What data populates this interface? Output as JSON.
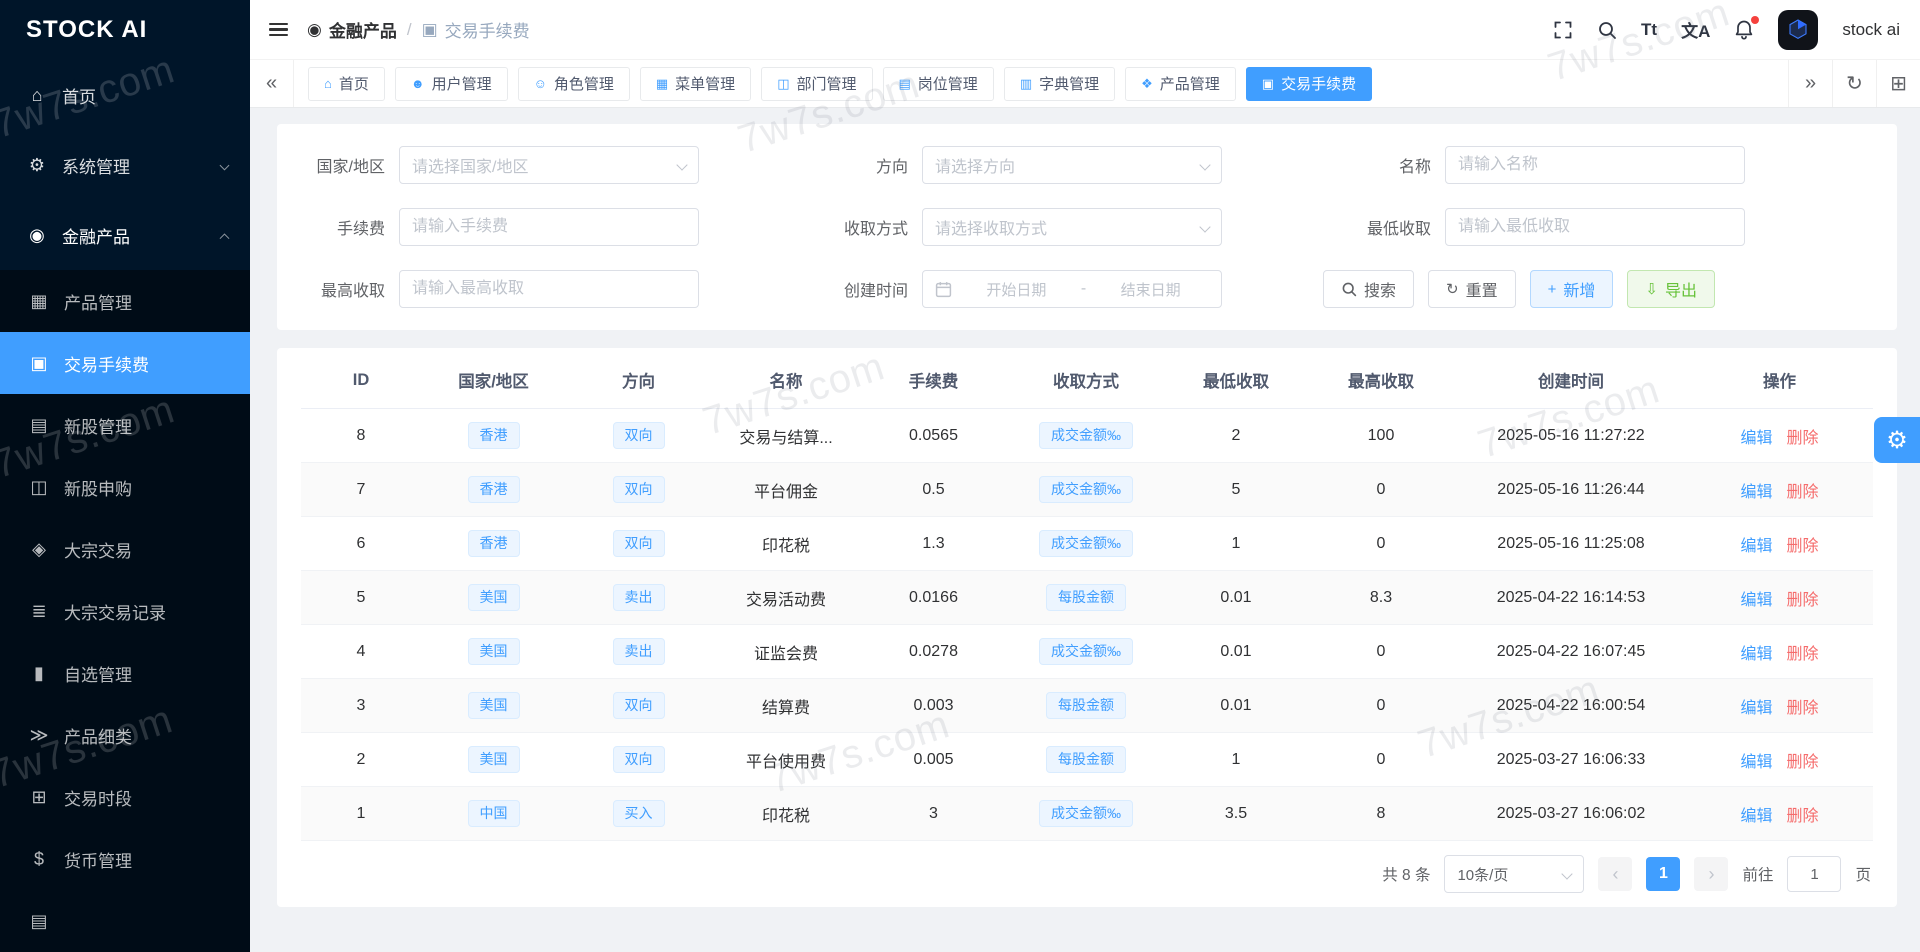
{
  "colors": {
    "primary": "#409eff",
    "danger": "#f56c6c",
    "success": "#67c23a",
    "sidebar_bg": "#001529"
  },
  "watermark": {
    "text": "7w7s.com"
  },
  "icons": {
    "collapse_left": "«",
    "collapse_right": "»",
    "refresh": "↻",
    "grid": "⊞",
    "plus": "+",
    "download": "⇩",
    "prev": "‹",
    "next": "›",
    "gear": "⚙"
  },
  "sidebar": {
    "logo": "STOCK AI",
    "items": [
      {
        "label": "首页",
        "icon": "⌂"
      },
      {
        "label": "系统管理",
        "icon": "⚙"
      },
      {
        "label": "金融产品",
        "icon": "◉"
      }
    ],
    "submenu": [
      {
        "label": "产品管理",
        "icon": "▦"
      },
      {
        "label": "交易手续费",
        "icon": "▣"
      },
      {
        "label": "新股管理",
        "icon": "▤"
      },
      {
        "label": "新股申购",
        "icon": "◫"
      },
      {
        "label": "大宗交易",
        "icon": "◈"
      },
      {
        "label": "大宗交易记录",
        "icon": "≣"
      },
      {
        "label": "自选管理",
        "icon": "▮"
      },
      {
        "label": "产品细类",
        "icon": "≫"
      },
      {
        "label": "交易时段",
        "icon": "⊞"
      },
      {
        "label": "货币管理",
        "icon": "$"
      },
      {
        "label": "",
        "icon": "▤"
      }
    ]
  },
  "header": {
    "breadcrumb": {
      "parent": "金融产品",
      "separator": "/",
      "current": "交易手续费"
    },
    "tools": {
      "font_size": "Tt",
      "translate": "文A"
    },
    "username": "stock ai"
  },
  "tabs": [
    {
      "label": "首页",
      "icon": "⌂"
    },
    {
      "label": "用户管理",
      "icon": "☻"
    },
    {
      "label": "角色管理",
      "icon": "☺"
    },
    {
      "label": "菜单管理",
      "icon": "▦"
    },
    {
      "label": "部门管理",
      "icon": "◫"
    },
    {
      "label": "岗位管理",
      "icon": "▤"
    },
    {
      "label": "字典管理",
      "icon": "▥"
    },
    {
      "label": "产品管理",
      "icon": "❖"
    },
    {
      "label": "交易手续费",
      "icon": "▣"
    }
  ],
  "filters": {
    "fields": [
      {
        "label": "国家/地区",
        "placeholder": "请选择国家/地区"
      },
      {
        "label": "方向",
        "placeholder": "请选择方向"
      },
      {
        "label": "名称",
        "placeholder": "请输入名称"
      },
      {
        "label": "手续费",
        "placeholder": "请输入手续费"
      },
      {
        "label": "收取方式",
        "placeholder": "请选择收取方式"
      },
      {
        "label": "最低收取",
        "placeholder": "请输入最低收取"
      },
      {
        "label": "最高收取",
        "placeholder": "请输入最高收取"
      },
      {
        "label": "创建时间",
        "start_placeholder": "开始日期",
        "separator": "-",
        "end_placeholder": "结束日期"
      }
    ],
    "buttons": {
      "search": "搜索",
      "reset": "重置",
      "add": "新增",
      "export": "导出"
    }
  },
  "table": {
    "columns": [
      "ID",
      "国家/地区",
      "方向",
      "名称",
      "手续费",
      "收取方式",
      "最低收取",
      "最高收取",
      "创建时间",
      "操作"
    ],
    "edit_label": "编辑",
    "delete_label": "删除",
    "rows": [
      {
        "id": "8",
        "country": "香港",
        "direction": "双向",
        "name": "交易与结算...",
        "fee": "0.0565",
        "method": "成交金额‰",
        "min": "2",
        "max": "100",
        "created": "2025-05-16 11:27:22"
      },
      {
        "id": "7",
        "country": "香港",
        "direction": "双向",
        "name": "平台佣金",
        "fee": "0.5",
        "method": "成交金额‰",
        "min": "5",
        "max": "0",
        "created": "2025-05-16 11:26:44"
      },
      {
        "id": "6",
        "country": "香港",
        "direction": "双向",
        "name": "印花税",
        "fee": "1.3",
        "method": "成交金额‰",
        "min": "1",
        "max": "0",
        "created": "2025-05-16 11:25:08"
      },
      {
        "id": "5",
        "country": "美国",
        "direction": "卖出",
        "name": "交易活动费",
        "fee": "0.0166",
        "method": "每股金额",
        "min": "0.01",
        "max": "8.3",
        "created": "2025-04-22 16:14:53"
      },
      {
        "id": "4",
        "country": "美国",
        "direction": "卖出",
        "name": "证监会费",
        "fee": "0.0278",
        "method": "成交金额‰",
        "min": "0.01",
        "max": "0",
        "created": "2025-04-22 16:07:45"
      },
      {
        "id": "3",
        "country": "美国",
        "direction": "双向",
        "name": "结算费",
        "fee": "0.003",
        "method": "每股金额",
        "min": "0.01",
        "max": "0",
        "created": "2025-04-22 16:00:54"
      },
      {
        "id": "2",
        "country": "美国",
        "direction": "双向",
        "name": "平台使用费",
        "fee": "0.005",
        "method": "每股金额",
        "min": "1",
        "max": "0",
        "created": "2025-03-27 16:06:33"
      },
      {
        "id": "1",
        "country": "中国",
        "direction": "买入",
        "name": "印花税",
        "fee": "3",
        "method": "成交金额‰",
        "min": "3.5",
        "max": "8",
        "created": "2025-03-27 16:06:02"
      }
    ]
  },
  "pagination": {
    "total": "共 8 条",
    "page_size": "10条/页",
    "current_page": "1",
    "goto_label": "前往",
    "goto_value": "1",
    "page_unit": "页"
  }
}
